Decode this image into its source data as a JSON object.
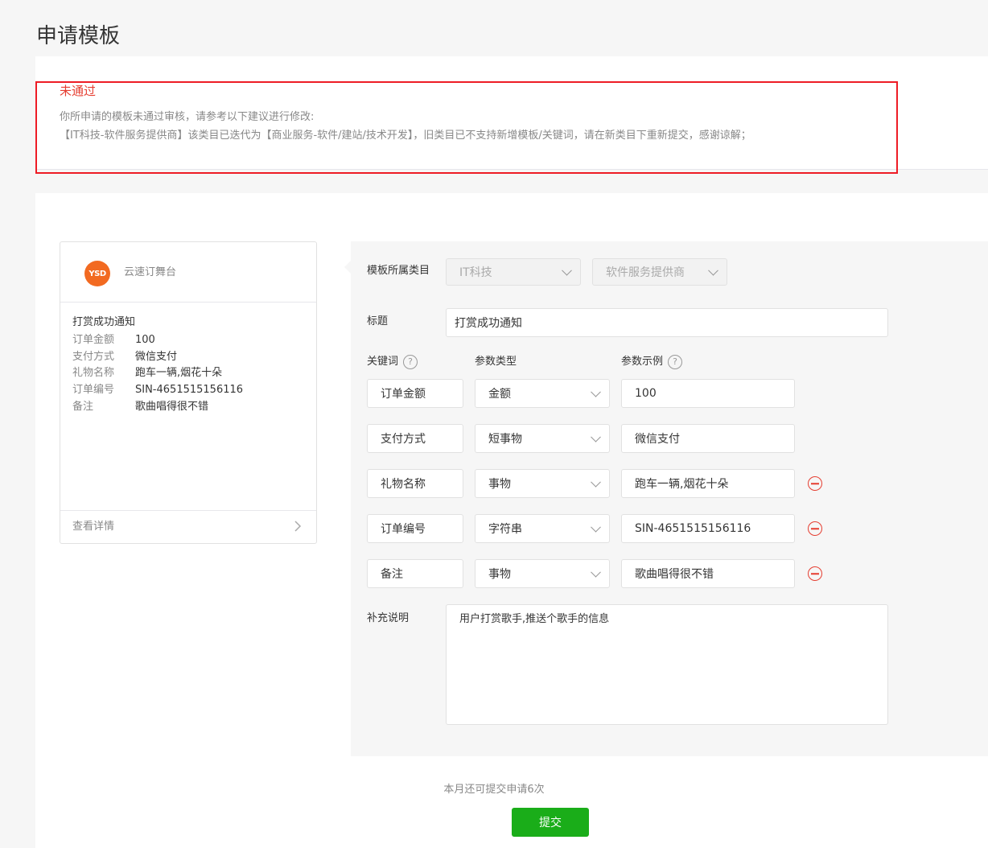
{
  "page": {
    "title": "申请模板"
  },
  "rejection": {
    "status": "未通过",
    "line1": "你所申请的模板未通过审核，请参考以下建议进行修改:",
    "line2": "【IT科技-软件服务提供商】该类目已迭代为【商业服务-软件/建站/技术开发】，旧类目已不支持新增模板/关键词，请在新类目下重新提交，感谢谅解；"
  },
  "preview": {
    "account_name": "云速订舞台",
    "logo_text": "YSD",
    "title": "打赏成功通知",
    "rows": [
      {
        "key": "订单金额",
        "value": "100"
      },
      {
        "key": "支付方式",
        "value": "微信支付"
      },
      {
        "key": "礼物名称",
        "value": "跑车一辆,烟花十朵"
      },
      {
        "key": "订单编号",
        "value": "SIN-4651515156116"
      },
      {
        "key": "备注",
        "value": "歌曲唱得很不错"
      }
    ],
    "detail_link": "查看详情"
  },
  "form": {
    "category_label": "模板所属类目",
    "category_primary": "IT科技",
    "category_secondary": "软件服务提供商",
    "title_label": "标题",
    "title_value": "打赏成功通知",
    "col_keyword": "关键词",
    "col_type": "参数类型",
    "col_example": "参数示例",
    "help_glyph": "?",
    "keywords": [
      {
        "name": "订单金额",
        "type": "金额",
        "example": "100",
        "removable": false
      },
      {
        "name": "支付方式",
        "type": "短事物",
        "example": "微信支付",
        "removable": false
      },
      {
        "name": "礼物名称",
        "type": "事物",
        "example": "跑车一辆,烟花十朵",
        "removable": true
      },
      {
        "name": "订单编号",
        "type": "字符串",
        "example": "SIN-4651515156116",
        "removable": true
      },
      {
        "name": "备注",
        "type": "事物",
        "example": "歌曲唱得很不错",
        "removable": true
      }
    ],
    "supplement_label": "补充说明",
    "supplement_value": "用户打赏歌手,推送个歌手的信息"
  },
  "footer": {
    "quota_text": "本月还可提交申请6次",
    "submit_label": "提交"
  },
  "colors": {
    "accent_green": "#1aad19",
    "error_red": "#e53d30",
    "highlight_red": "#ee1c25",
    "logo_orange": "#f26a21"
  }
}
